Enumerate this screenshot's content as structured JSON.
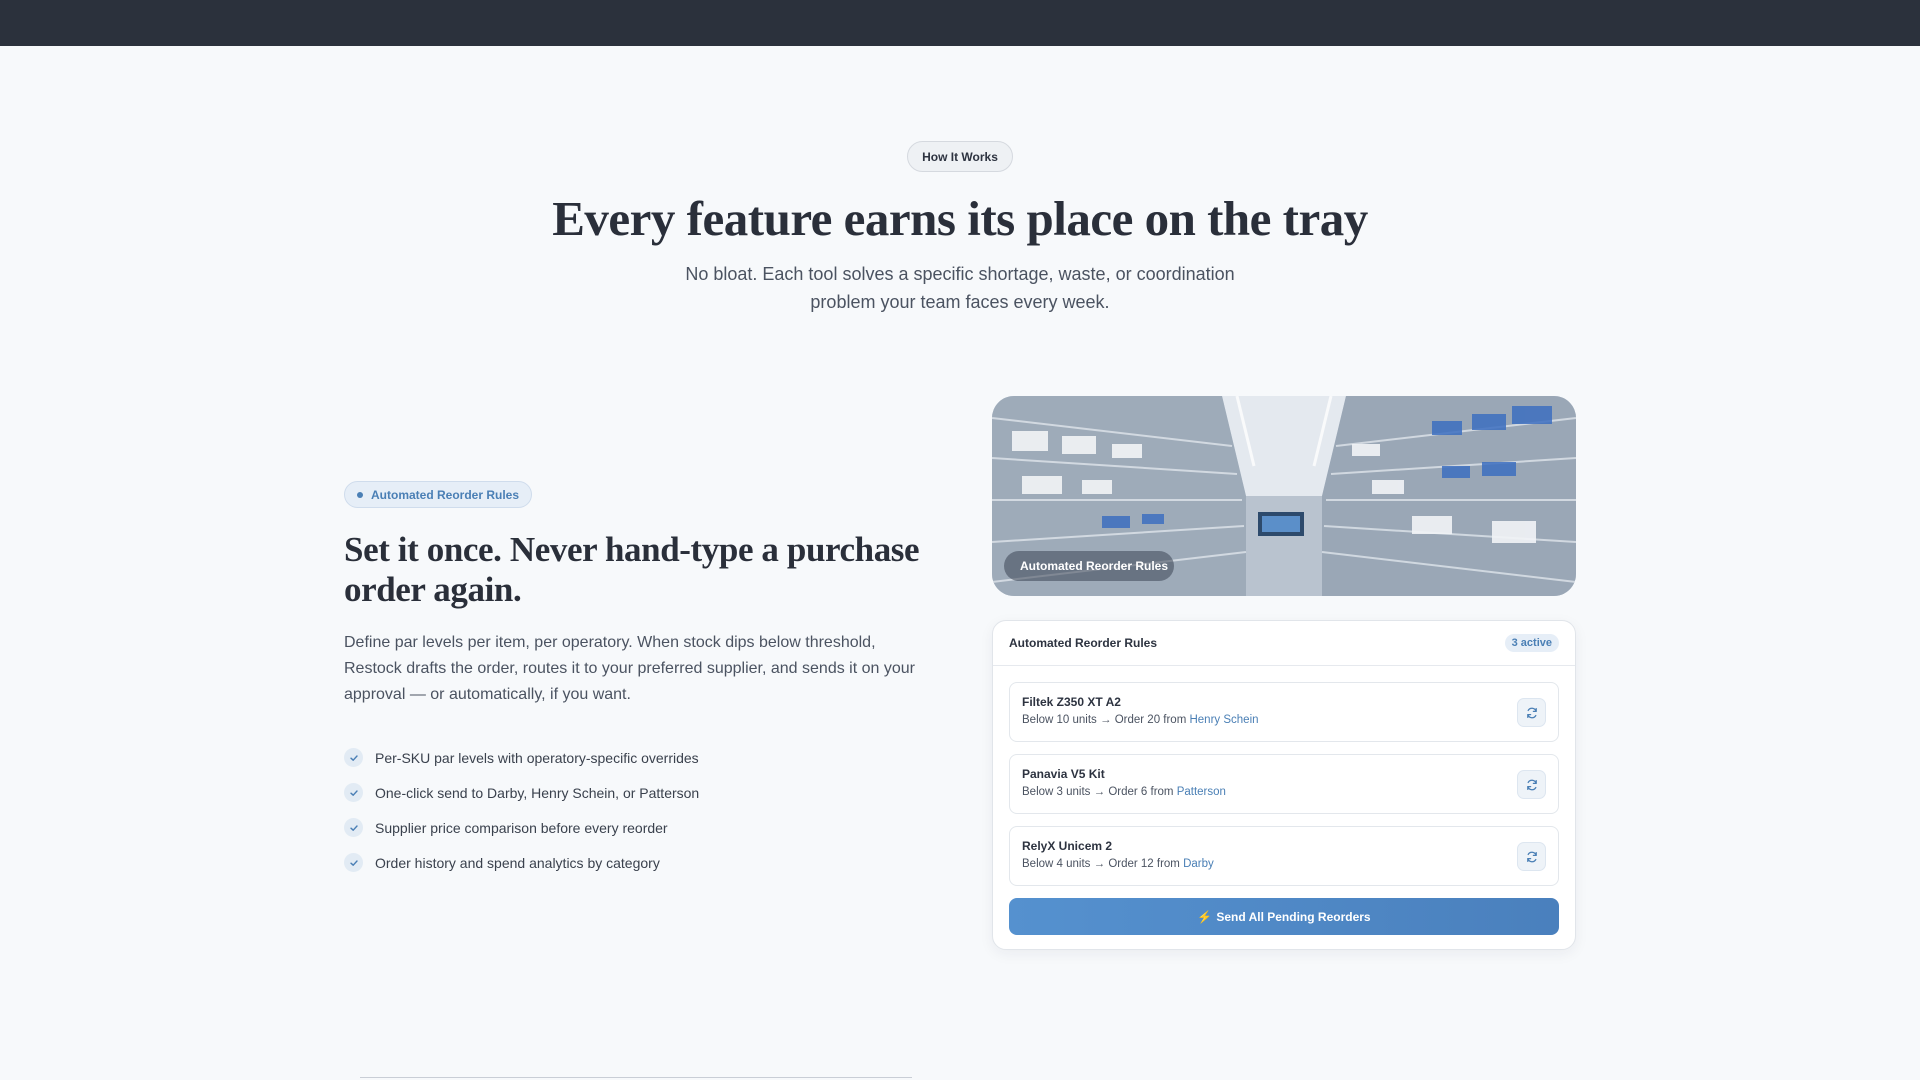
{
  "section": {
    "eyebrow": "How It Works",
    "title": "Every feature earns its place on the tray",
    "subtitle": "No bloat. Each tool solves a specific shortage, waste, or coordination problem your team faces every week."
  },
  "feature": {
    "pill_label": "Automated Reorder Rules",
    "title": "Set it once. Never hand-type a purchase order again.",
    "description": "Define par levels per item, per operatory. When stock dips below threshold, Restock drafts the order, routes it to your preferred supplier, and sends it on your approval — or automatically, if you want.",
    "checklist": [
      "Per-SKU par levels with operatory-specific overrides",
      "One-click send to Darby, Henry Schein, or Patterson",
      "Supplier price comparison before every reorder",
      "Order history and spend analytics by category"
    ]
  },
  "image_card": {
    "tag": "Automated Reorder Rules"
  },
  "rules_panel": {
    "title": "Automated Reorder Rules",
    "badge": "3 active",
    "rules": [
      {
        "name": "Filtek Z350 XT A2",
        "condition": "Below 10 units",
        "arrow": "→",
        "action": "Order 20 from",
        "supplier": "Henry Schein"
      },
      {
        "name": "Panavia V5 Kit",
        "condition": "Below 3 units",
        "arrow": "→",
        "action": "Order 6 from",
        "supplier": "Patterson"
      },
      {
        "name": "RelyX Unicem 2",
        "condition": "Below 4 units",
        "arrow": "→",
        "action": "Order 12 from",
        "supplier": "Darby"
      }
    ],
    "send_icon": "⚡",
    "send_label": "Send All Pending Reorders"
  },
  "colors": {
    "accent": "#4a7fb5",
    "topbar": "#2b313c",
    "background": "#f7f9fb"
  }
}
